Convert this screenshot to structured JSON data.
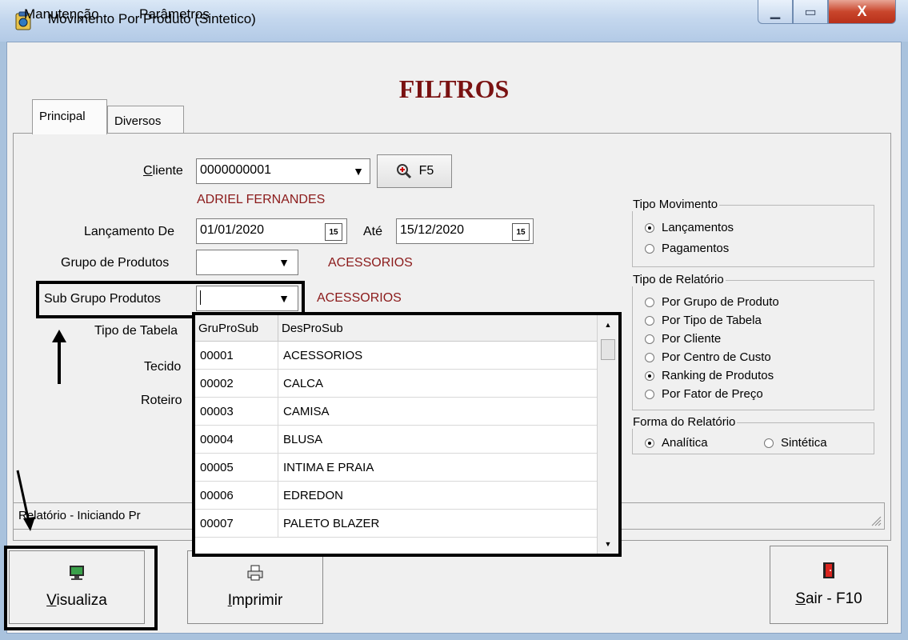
{
  "window": {
    "title": "Movimento Por Produto (Sintetico)",
    "minimize_glyph": "▁",
    "maximize_glyph": "▭",
    "close_glyph": "X"
  },
  "menu": [
    "Manutenção",
    "Parâmetros"
  ],
  "header": {
    "title": "FILTROS"
  },
  "tabs": [
    {
      "label": "Principal",
      "active": true
    },
    {
      "label": "Diversos",
      "active": false
    }
  ],
  "form": {
    "cliente_label_first": "C",
    "cliente_label_rest": "liente",
    "cliente_value": "0000000001",
    "search_button_label": "F5",
    "cliente_name": "ADRIEL FERNANDES",
    "lancamento_de_label": "Lançamento De",
    "lancamento_de_value": "01/01/2020",
    "ate_label": "Até",
    "ate_value": "15/12/2020",
    "calendar_glyph": "15",
    "grupo_label": "Grupo de Produtos",
    "grupo_value": "",
    "grupo_desc": "ACESSORIOS",
    "subgrupo_label": "Sub Grupo Produtos",
    "subgrupo_value": "",
    "subgrupo_desc": "ACESSORIOS",
    "tipo_tabela_label": "Tipo de Tabela",
    "tecido_label": "Tecido",
    "roteiro_label": "Roteiro"
  },
  "tipo_movimento": {
    "title": "Tipo Movimento",
    "options": [
      {
        "label": "Lançamentos",
        "checked": true
      },
      {
        "label": "Pagamentos",
        "checked": false
      }
    ]
  },
  "tipo_relatorio": {
    "title": "Tipo de Relatório",
    "options": [
      {
        "label": "Por Grupo de Produto",
        "checked": false
      },
      {
        "label": "Por Tipo de Tabela",
        "checked": false
      },
      {
        "label": "Por Cliente",
        "checked": false
      },
      {
        "label": "Por Centro de Custo",
        "checked": false
      },
      {
        "label": "Ranking de Produtos",
        "checked": true
      },
      {
        "label": "Por Fator de Preço",
        "checked": false
      }
    ]
  },
  "forma_relatorio": {
    "title": "Forma do Relatório",
    "options": [
      {
        "label": "Analítica",
        "checked": true
      },
      {
        "label": "Sintética",
        "checked": false
      }
    ]
  },
  "status": {
    "text": "Relatório - Iniciando Pr"
  },
  "dropdown_grid": {
    "columns": [
      "GruProSub",
      "DesProSub"
    ],
    "rows": [
      [
        "00001",
        "ACESSORIOS"
      ],
      [
        "00002",
        "CALCA"
      ],
      [
        "00003",
        "CAMISA"
      ],
      [
        "00004",
        "BLUSA"
      ],
      [
        "00005",
        "INTIMA E PRAIA"
      ],
      [
        "00006",
        "EDREDON"
      ],
      [
        "00007",
        "PALETO BLAZER"
      ]
    ],
    "scroll_up_glyph": "▲",
    "scroll_down_glyph": "▼"
  },
  "buttons": {
    "visualiza_first": "V",
    "visualiza_rest": "isualiza",
    "imprimir_first": "I",
    "imprimir_rest": "mprimir",
    "sair_first": "S",
    "sair_rest": "air - F10"
  },
  "icons": {
    "app": "clipboard-icon",
    "search": "magnifier-icon",
    "visualiza": "monitor-icon",
    "imprimir": "printer-icon",
    "sair": "door-icon"
  },
  "colors": {
    "title_red": "#7a1212",
    "desc_red": "#8b1a1a",
    "chrome_blue": "#a9c2dd",
    "close_red": "#c9462c"
  }
}
